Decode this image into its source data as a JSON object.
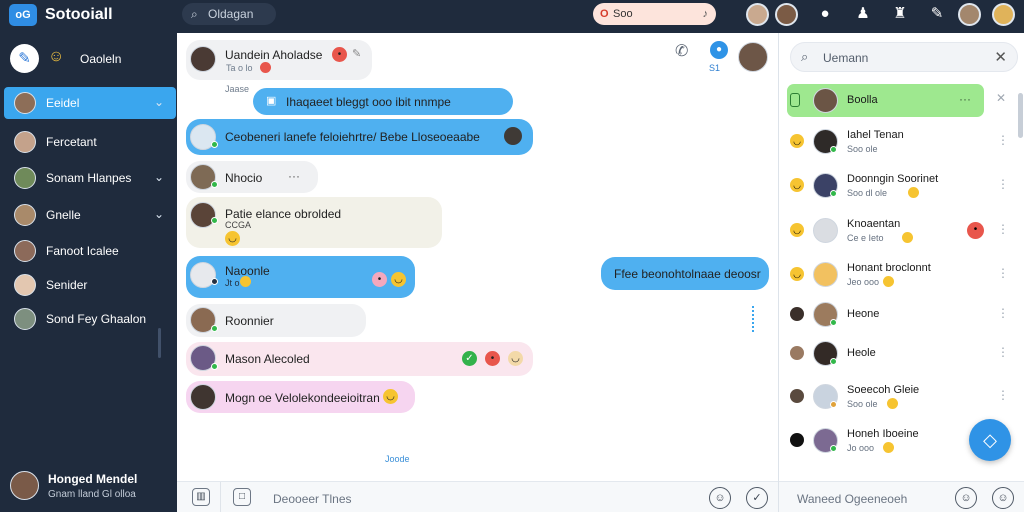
{
  "app": {
    "logo": "oG",
    "title": "Sotooiall"
  },
  "topbar": {
    "search_label": "Oldagan",
    "pill_label": "Soo",
    "icons": [
      "user-avatar-icon",
      "chat-bubble-icon",
      "person-icon",
      "bell-icon",
      "bookmark-icon"
    ]
  },
  "sidebar": {
    "header_label": "Oaoleln",
    "items": [
      {
        "label": "Eeidel"
      },
      {
        "label": "Fercetant"
      },
      {
        "label": "Sonam Hlanpes"
      },
      {
        "label": "Gnelle"
      },
      {
        "label": "Fanoot Icalee"
      },
      {
        "label": "Senider"
      },
      {
        "label": "Sond Fey Ghaalon"
      }
    ],
    "profile": {
      "name": "Honged Mendel",
      "status": "Gnam lland Gl olloa"
    }
  },
  "chat": {
    "header_meta": "S1",
    "messages": [
      {
        "text": "Uandein Aholadse",
        "meta": "Ta o lo"
      },
      {
        "meta": "Jaase"
      },
      {
        "text": "Ihaqaeet bleggt ooo ibit nnmpe"
      },
      {
        "text": "Ceobeneri lanefe feloiehrtre/ Bebe Lloseoeaabe"
      },
      {
        "text": "Nhocio"
      },
      {
        "text": "Patie elance obrolded",
        "meta": "CCGA"
      },
      {
        "text": "Naoonle",
        "meta": "Jt o"
      },
      {
        "text": "Ffee beonohtolnaae deoosr"
      },
      {
        "text": "Roonnier"
      },
      {
        "text": "Mason Alecoled"
      },
      {
        "text": "Mogn oe Velolekondeeioitran"
      },
      {
        "meta": "Joode"
      }
    ],
    "composer_placeholder": "Deooeer Tlnes"
  },
  "right_panel": {
    "search_placeholder": "Uemann",
    "contacts": [
      {
        "name": "Boolla"
      },
      {
        "name": "Iahel Tenan",
        "status": "Soo ole"
      },
      {
        "name": "Doonngin Soorinet",
        "status": "Soo dl ole"
      },
      {
        "name": "Knoaentan",
        "status": "Ce e Ieto"
      },
      {
        "name": "Honant broclonnt",
        "status": "Jeo ooo"
      },
      {
        "name": "Heone"
      },
      {
        "name": "Heole"
      },
      {
        "name": "Soeecoh Gleie",
        "status": "Soo ole"
      },
      {
        "name": "Honeh Iboeine",
        "status": "Jo ooo"
      }
    ],
    "composer_placeholder": "Waneed Ogeeneoeh"
  },
  "colors": {
    "accent": "#3aa6ee",
    "sidebar_bg": "#1f2b3d",
    "active_contact": "#9ee88f"
  }
}
